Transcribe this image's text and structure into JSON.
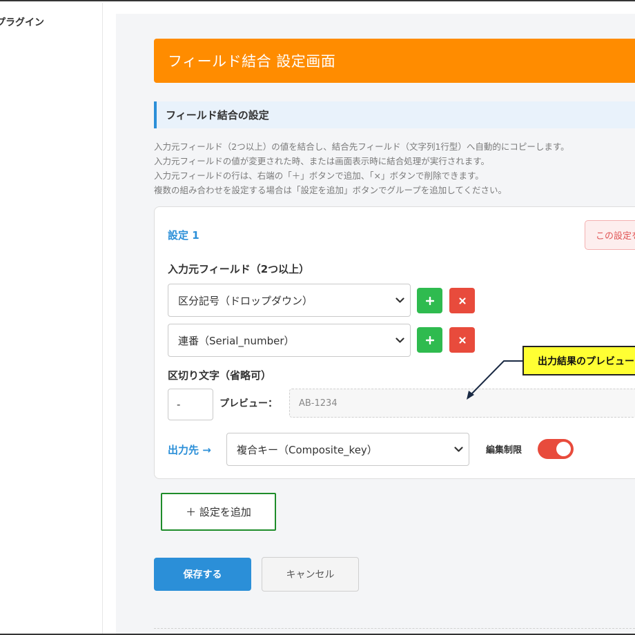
{
  "sidebar": {
    "title": "プラグイン"
  },
  "header": {
    "title": "フィールド結合 設定画面"
  },
  "section": {
    "title": "フィールド結合の設定"
  },
  "description": [
    "入力元フィールド（2つ以上）の値を結合し、結合先フィールド（文字列1行型）へ自動的にコピーします。",
    "入力元フィールドの値が変更された時、または画面表示時に結合処理が実行されます。",
    "入力元フィールドの行は、右端の「＋」ボタンで追加、「×」ボタンで削除できます。",
    "複数の組み合わせを設定する場合は「設定を追加」ボタンでグループを追加してください。"
  ],
  "setting": {
    "label": "設定 1",
    "delete_label": "この設定を削除",
    "source_label": "入力元フィールド（2つ以上）",
    "sources": [
      {
        "value": "区分記号（ドロップダウン）"
      },
      {
        "value": "連番（Serial_number）"
      }
    ],
    "separator_label": "区切り文字（省略可）",
    "separator_value": "-",
    "preview_label": "プレビュー：",
    "preview_value": "AB-1234",
    "output_label": "出力先 →",
    "output_value": "複合キー（Composite_key）",
    "edit_lock_label": "編集制限",
    "edit_lock_on": true
  },
  "callout": {
    "text": "出力結果のプレビュー"
  },
  "actions": {
    "add_setting_label": "＋ 設定を追加",
    "save_label": "保存する",
    "cancel_label": "キャンセル"
  },
  "colors": {
    "accent_orange": "#ff8c00",
    "primary_blue": "#2b8fd8",
    "add_green": "#2fbb4f",
    "remove_red": "#e84b3c",
    "callout_yellow": "#ffff33"
  }
}
